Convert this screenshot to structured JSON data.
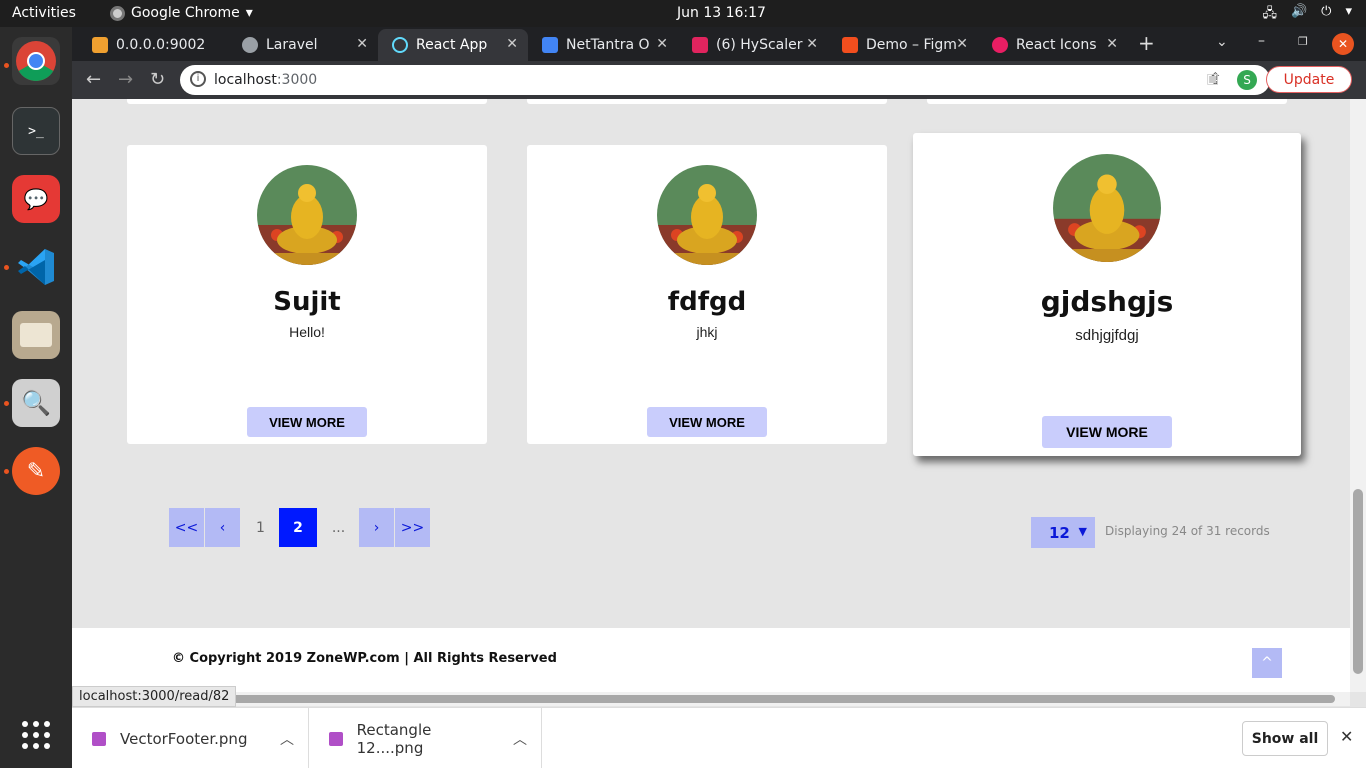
{
  "system": {
    "activities": "Activities",
    "app_name": "Google Chrome",
    "clock": "Jun 13  16:17"
  },
  "dock": {
    "items": [
      "chrome-icon",
      "terminal-icon",
      "rocketchat-icon",
      "vscode-icon",
      "files-icon",
      "image-viewer-icon",
      "postman-icon",
      "app-grid-icon"
    ]
  },
  "tabs": [
    {
      "label": "0.0.0.0:9002",
      "icon_color": "#f0a030"
    },
    {
      "label": "Laravel",
      "icon_color": "#9aa0a6"
    },
    {
      "label": "React App",
      "icon_color": "#61dafb",
      "active": true
    },
    {
      "label": "NetTantra O",
      "icon_color": "#4285f4"
    },
    {
      "label": "(6) HyScaler",
      "icon_color": "#e0245e"
    },
    {
      "label": "Demo – Figm",
      "icon_color": "#f24e1e"
    },
    {
      "label": "React Icons",
      "icon_color": "#e91e63"
    }
  ],
  "toolbar": {
    "url_host": "localhost",
    "url_port": ":3000",
    "update_label": "Update",
    "profile_initial": "S"
  },
  "cards": [
    {
      "name": "Sujit",
      "bio": "Hello!",
      "button": "VIEW MORE"
    },
    {
      "name": "fdfgd",
      "bio": "jhkj",
      "button": "VIEW MORE"
    },
    {
      "name": "gjdshgjs",
      "bio": "sdhjgjfdgj",
      "button": "VIEW MORE"
    }
  ],
  "pagination": {
    "first": "<<",
    "prev": "‹",
    "page1": "1",
    "current": "2",
    "ellipsis": "...",
    "next": "›",
    "last": ">>",
    "per_page": "12",
    "summary": "Displaying 24 of 31 records"
  },
  "footer": {
    "copyright": "© Copyright 2019 ZoneWP.com | All Rights Reserved",
    "scroll_top": "^"
  },
  "status_url": "localhost:3000/read/82",
  "downloads": {
    "items": [
      "VectorFooter.png",
      "Rectangle 12....png"
    ],
    "show_all": "Show all"
  },
  "colors": {
    "accent": "#0019ff",
    "button_bg": "#c9cdfc",
    "page_bg": "#e5e5e5"
  }
}
